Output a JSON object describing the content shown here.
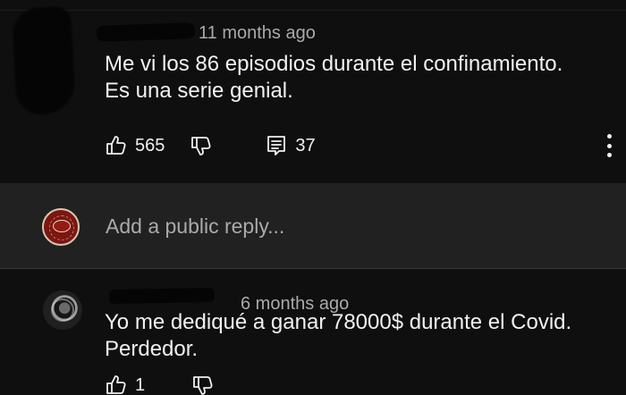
{
  "comments": [
    {
      "timestamp": "11 months ago",
      "text": "Me vi los 86 episodios durante el confinamiento.\nEs una serie genial.",
      "likes": "565",
      "replies": "37"
    },
    {
      "timestamp": "6 months ago",
      "text": "Yo me dediqué a ganar 78000$ durante el Covid.\nPerdedor.",
      "likes": "1"
    }
  ],
  "reply_box": {
    "placeholder": "Add a public reply..."
  },
  "icons": {
    "like": "thumbs-up-icon",
    "dislike": "thumbs-down-icon",
    "reply": "comment-reply-icon",
    "menu": "more-vertical-icon"
  },
  "colors": {
    "background": "#0f0f0f",
    "reply_panel": "#212121",
    "primary_text": "#f1f1f1",
    "secondary_text": "#aaaaaa",
    "channel_avatar": "#7c1610"
  }
}
